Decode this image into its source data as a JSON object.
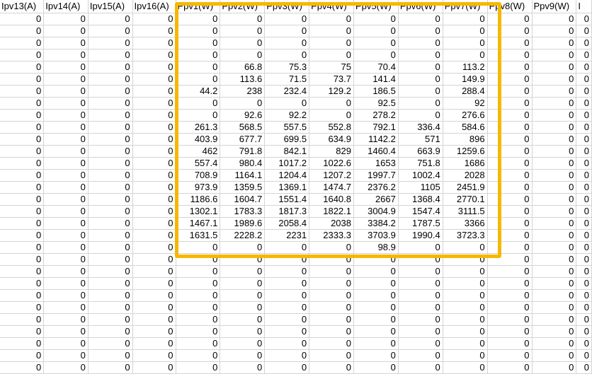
{
  "headers": [
    "Ipv13(A)",
    "Ipv14(A)",
    "Ipv15(A)",
    "Ipv16(A)",
    "Ppv1(W)",
    "Ppv2(W)",
    "Ppv3(W)",
    "Ppv4(W)",
    "Ppv5(W)",
    "Ppv6(W)",
    "Ppv7(W)",
    "Ppv8(W)",
    "Ppv9(W)",
    "I"
  ],
  "rows": [
    [
      "0",
      "0",
      "0",
      "0",
      "0",
      "0",
      "0",
      "0",
      "0",
      "0",
      "0",
      "0",
      "0",
      "0"
    ],
    [
      "0",
      "0",
      "0",
      "0",
      "0",
      "0",
      "0",
      "0",
      "0",
      "0",
      "0",
      "0",
      "0",
      "0"
    ],
    [
      "0",
      "0",
      "0",
      "0",
      "0",
      "0",
      "0",
      "0",
      "0",
      "0",
      "0",
      "0",
      "0",
      "0"
    ],
    [
      "0",
      "0",
      "0",
      "0",
      "0",
      "0",
      "0",
      "0",
      "0",
      "0",
      "0",
      "0",
      "0",
      "0"
    ],
    [
      "0",
      "0",
      "0",
      "0",
      "0",
      "66.8",
      "75.3",
      "75",
      "70.4",
      "0",
      "113.2",
      "0",
      "0",
      "0"
    ],
    [
      "0",
      "0",
      "0",
      "0",
      "0",
      "113.6",
      "71.5",
      "73.7",
      "141.4",
      "0",
      "149.9",
      "0",
      "0",
      "0"
    ],
    [
      "0",
      "0",
      "0",
      "0",
      "44.2",
      "238",
      "232.4",
      "129.2",
      "186.5",
      "0",
      "288.4",
      "0",
      "0",
      "0"
    ],
    [
      "0",
      "0",
      "0",
      "0",
      "0",
      "0",
      "0",
      "0",
      "92.5",
      "0",
      "92",
      "0",
      "0",
      "0"
    ],
    [
      "0",
      "0",
      "0",
      "0",
      "0",
      "92.6",
      "92.2",
      "0",
      "278.2",
      "0",
      "276.6",
      "0",
      "0",
      "0"
    ],
    [
      "0",
      "0",
      "0",
      "0",
      "261.3",
      "568.5",
      "557.5",
      "552.8",
      "792.1",
      "336.4",
      "584.6",
      "0",
      "0",
      "0"
    ],
    [
      "0",
      "0",
      "0",
      "0",
      "403.9",
      "677.7",
      "699.5",
      "634.9",
      "1142.2",
      "571",
      "896",
      "0",
      "0",
      "0"
    ],
    [
      "0",
      "0",
      "0",
      "0",
      "462",
      "791.8",
      "842.1",
      "829",
      "1460.4",
      "663.9",
      "1259.6",
      "0",
      "0",
      "0"
    ],
    [
      "0",
      "0",
      "0",
      "0",
      "557.4",
      "980.4",
      "1017.2",
      "1022.6",
      "1653",
      "751.8",
      "1686",
      "0",
      "0",
      "0"
    ],
    [
      "0",
      "0",
      "0",
      "0",
      "708.9",
      "1164.1",
      "1204.4",
      "1207.2",
      "1997.7",
      "1002.4",
      "2028",
      "0",
      "0",
      "0"
    ],
    [
      "0",
      "0",
      "0",
      "0",
      "973.9",
      "1359.5",
      "1369.1",
      "1474.7",
      "2376.2",
      "1105",
      "2451.9",
      "0",
      "0",
      "0"
    ],
    [
      "0",
      "0",
      "0",
      "0",
      "1186.6",
      "1604.7",
      "1551.4",
      "1640.8",
      "2667",
      "1368.4",
      "2770.1",
      "0",
      "0",
      "0"
    ],
    [
      "0",
      "0",
      "0",
      "0",
      "1302.1",
      "1783.3",
      "1817.3",
      "1822.1",
      "3004.9",
      "1547.4",
      "3111.5",
      "0",
      "0",
      "0"
    ],
    [
      "0",
      "0",
      "0",
      "0",
      "1467.1",
      "1989.6",
      "2058.4",
      "2038",
      "3384.2",
      "1787.5",
      "3366",
      "0",
      "0",
      "0"
    ],
    [
      "0",
      "0",
      "0",
      "0",
      "1631.5",
      "2228.2",
      "2231",
      "2333.3",
      "3703.9",
      "1990.4",
      "3723.3",
      "0",
      "0",
      "0"
    ],
    [
      "0",
      "0",
      "0",
      "0",
      "0",
      "0",
      "0",
      "0",
      "98.9",
      "0",
      "0",
      "0",
      "0",
      "0"
    ],
    [
      "0",
      "0",
      "0",
      "0",
      "0",
      "0",
      "0",
      "0",
      "0",
      "0",
      "0",
      "0",
      "0",
      "0"
    ],
    [
      "0",
      "0",
      "0",
      "0",
      "0",
      "0",
      "0",
      "0",
      "0",
      "0",
      "0",
      "0",
      "0",
      "0"
    ],
    [
      "0",
      "0",
      "0",
      "0",
      "0",
      "0",
      "0",
      "0",
      "0",
      "0",
      "0",
      "0",
      "0",
      "0"
    ],
    [
      "0",
      "0",
      "0",
      "0",
      "0",
      "0",
      "0",
      "0",
      "0",
      "0",
      "0",
      "0",
      "0",
      "0"
    ],
    [
      "0",
      "0",
      "0",
      "0",
      "0",
      "0",
      "0",
      "0",
      "0",
      "0",
      "0",
      "0",
      "0",
      "0"
    ],
    [
      "0",
      "0",
      "0",
      "0",
      "0",
      "0",
      "0",
      "0",
      "0",
      "0",
      "0",
      "0",
      "0",
      "0"
    ],
    [
      "0",
      "0",
      "0",
      "0",
      "0",
      "0",
      "0",
      "0",
      "0",
      "0",
      "0",
      "0",
      "0",
      "0"
    ],
    [
      "0",
      "0",
      "0",
      "0",
      "0",
      "0",
      "0",
      "0",
      "0",
      "0",
      "0",
      "0",
      "0",
      "0"
    ],
    [
      "0",
      "0",
      "0",
      "0",
      "0",
      "0",
      "0",
      "0",
      "0",
      "0",
      "0",
      "0",
      "0",
      "0"
    ],
    [
      "0",
      "0",
      "0",
      "0",
      "0",
      "0",
      "0",
      "0",
      "0",
      "0",
      "0",
      "0",
      "0",
      "0"
    ]
  ],
  "highlight": {
    "color": "#f5b800"
  }
}
